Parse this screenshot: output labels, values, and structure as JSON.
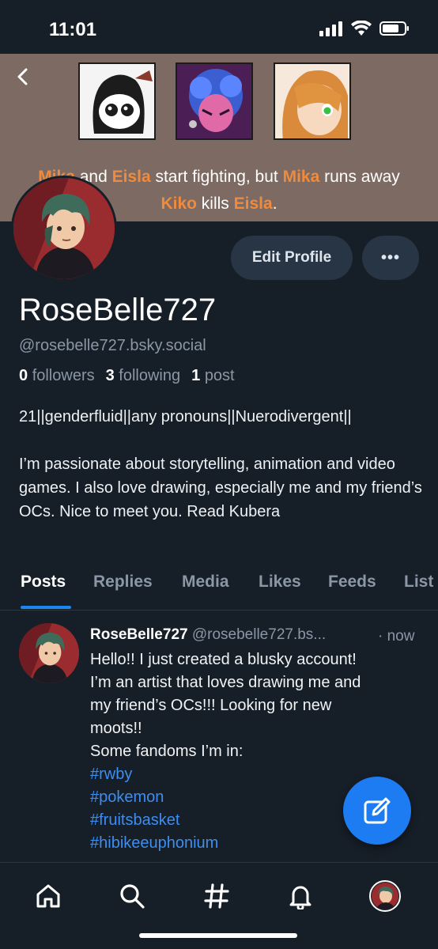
{
  "status_bar": {
    "time": "11:01"
  },
  "banner": {
    "caption_line1": [
      {
        "text": "Mika",
        "highlight": true
      },
      {
        "text": " and ",
        "highlight": false
      },
      {
        "text": "Eisla",
        "highlight": true
      },
      {
        "text": " start fighting, but ",
        "highlight": false
      },
      {
        "text": "Mika",
        "highlight": true
      },
      {
        "text": " runs away",
        "highlight": false
      }
    ],
    "caption_line2": [
      {
        "text": "Kiko",
        "highlight": true
      },
      {
        "text": " kills ",
        "highlight": false
      },
      {
        "text": "Eisla",
        "highlight": true
      },
      {
        "text": ".",
        "highlight": false
      }
    ]
  },
  "profile": {
    "edit_label": "Edit Profile",
    "more_label": "•••",
    "display_name": "RoseBelle727",
    "handle": "@rosebelle727.bsky.social",
    "followers_count": "0",
    "followers_label": "followers",
    "following_count": "3",
    "following_label": "following",
    "posts_count": "1",
    "posts_label": "post",
    "bio_line1": "21||genderfluid||any pronouns||Nuerodivergent||",
    "bio_line2": "I’m passionate about storytelling, animation and video games. I also love drawing, especially me and my friend’s OCs. Nice to meet you. Read Kubera"
  },
  "tabs": [
    "Posts",
    "Replies",
    "Media",
    "Likes",
    "Feeds",
    "List"
  ],
  "post": {
    "author": "RoseBelle727",
    "handle": "@rosebelle727.bs...",
    "time": "· now",
    "text_lines": [
      "Hello!! I just created a blusky account!",
      "I’m an artist that loves drawing me and",
      "my friend’s OCs!!! Looking for new",
      "moots!!",
      "Some fandoms I’m in:"
    ],
    "tags": [
      "#rwby",
      "#pokemon",
      "#fruitsbasket",
      "#hibikeeuphonium"
    ]
  },
  "colors": {
    "background": "#161e27",
    "accent": "#1d7cf2",
    "muted": "#8a97a6",
    "banner_highlight": "#f08a3c"
  },
  "icons": {
    "nav": [
      "home-icon",
      "search-icon",
      "hashtag-icon",
      "bell-icon",
      "profile-avatar"
    ],
    "fab": "compose-icon"
  }
}
